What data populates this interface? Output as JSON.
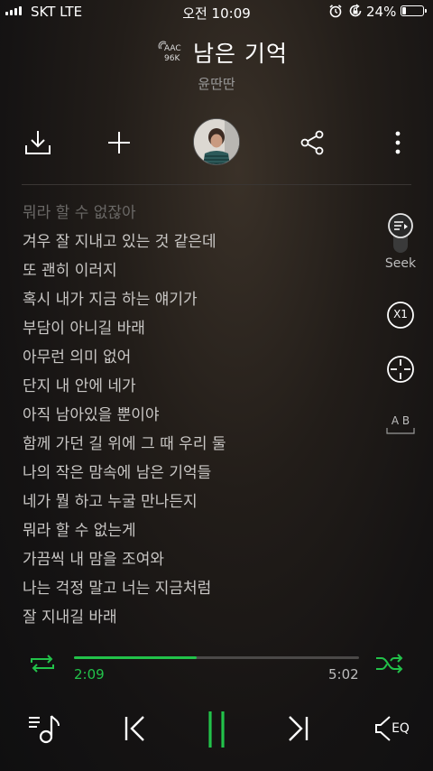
{
  "status_bar": {
    "carrier": "SKT LTE",
    "time": "오전 10:09",
    "battery_percent": "24%",
    "battery_level": 0.24,
    "icons": [
      "signal-bars-icon",
      "alarm-icon",
      "rotation-lock-icon",
      "battery-icon"
    ]
  },
  "header": {
    "codec_line1": "AAC",
    "codec_line2": "96K",
    "title": "남은 기억",
    "artist": "윤딴딴"
  },
  "actions": [
    "download-icon",
    "add-icon",
    "album-art",
    "share-icon",
    "more-icon"
  ],
  "lyrics": {
    "lines": [
      "뭐라 할 수 없잖아",
      "겨우 잘 지내고 있는 것 같은데",
      "또 괜히 이러지",
      "혹시 내가 지금 하는 얘기가",
      "부담이 아니길 바래",
      "아무런 의미 없어",
      "단지 내 안에 네가",
      "아직 남아있을 뿐이야",
      "함께 가던 길 위에 그 때 우리 둘",
      "나의 작은 맘속에 남은 기억들",
      "네가 뭘 하고 누굴 만나든지",
      "뭐라 할 수 없는게",
      "가끔씩 내 맘을 조여와",
      "나는 걱정 말고 너는 지금처럼",
      "잘 지내길 바래"
    ]
  },
  "side_controls": {
    "seek_label": "Seek",
    "speed_label": "X1",
    "ab_label": "A B"
  },
  "playback": {
    "current_time": "2:09",
    "total_time": "5:02",
    "progress": 0.43,
    "accent_color": "#22c24a"
  },
  "bottom_bar": {
    "eq_label": "EQ"
  }
}
